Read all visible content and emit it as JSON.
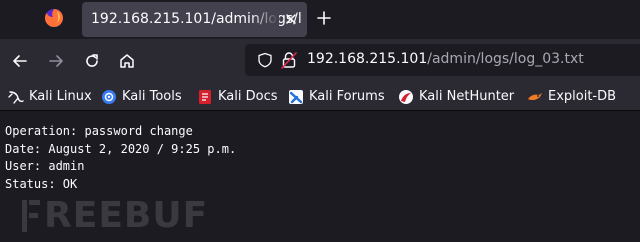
{
  "tab": {
    "title": "192.168.215.101/admin/logs/l"
  },
  "urlbar": {
    "host": "192.168.215.101",
    "path": "/admin/logs/log_03.txt"
  },
  "bookmarks": [
    {
      "label": "Kali Linux",
      "icon": "kali-dragon-icon"
    },
    {
      "label": "Kali Tools",
      "icon": "kali-tools-icon"
    },
    {
      "label": "Kali Docs",
      "icon": "kali-docs-icon"
    },
    {
      "label": "Kali Forums",
      "icon": "kali-forums-icon"
    },
    {
      "label": "Kali NetHunter",
      "icon": "kali-nethunter-icon"
    },
    {
      "label": "Exploit-DB",
      "icon": "exploit-db-icon"
    }
  ],
  "log": {
    "lines": [
      "Operation: password change",
      "Date: August 2, 2020 / 9:25 p.m.",
      "User: admin",
      "Status: OK"
    ]
  },
  "watermark": {
    "text": "REEBUF"
  },
  "colors": {
    "tab_bg": "#42414d",
    "toolbar_bg": "#2b2a33",
    "page_bg": "#1c1b22",
    "text": "#fbfbfe",
    "url_path": "#a8a8b3"
  }
}
